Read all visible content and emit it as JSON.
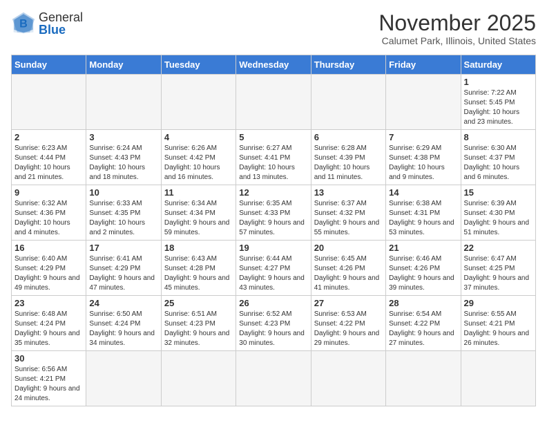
{
  "logo": {
    "general": "General",
    "blue": "Blue"
  },
  "header": {
    "month_year": "November 2025",
    "location": "Calumet Park, Illinois, United States"
  },
  "weekdays": [
    "Sunday",
    "Monday",
    "Tuesday",
    "Wednesday",
    "Thursday",
    "Friday",
    "Saturday"
  ],
  "weeks": [
    [
      {
        "day": "",
        "info": ""
      },
      {
        "day": "",
        "info": ""
      },
      {
        "day": "",
        "info": ""
      },
      {
        "day": "",
        "info": ""
      },
      {
        "day": "",
        "info": ""
      },
      {
        "day": "",
        "info": ""
      },
      {
        "day": "1",
        "info": "Sunrise: 7:22 AM\nSunset: 5:45 PM\nDaylight: 10 hours and 23 minutes."
      }
    ],
    [
      {
        "day": "2",
        "info": "Sunrise: 6:23 AM\nSunset: 4:44 PM\nDaylight: 10 hours and 21 minutes."
      },
      {
        "day": "3",
        "info": "Sunrise: 6:24 AM\nSunset: 4:43 PM\nDaylight: 10 hours and 18 minutes."
      },
      {
        "day": "4",
        "info": "Sunrise: 6:26 AM\nSunset: 4:42 PM\nDaylight: 10 hours and 16 minutes."
      },
      {
        "day": "5",
        "info": "Sunrise: 6:27 AM\nSunset: 4:41 PM\nDaylight: 10 hours and 13 minutes."
      },
      {
        "day": "6",
        "info": "Sunrise: 6:28 AM\nSunset: 4:39 PM\nDaylight: 10 hours and 11 minutes."
      },
      {
        "day": "7",
        "info": "Sunrise: 6:29 AM\nSunset: 4:38 PM\nDaylight: 10 hours and 9 minutes."
      },
      {
        "day": "8",
        "info": "Sunrise: 6:30 AM\nSunset: 4:37 PM\nDaylight: 10 hours and 6 minutes."
      }
    ],
    [
      {
        "day": "9",
        "info": "Sunrise: 6:32 AM\nSunset: 4:36 PM\nDaylight: 10 hours and 4 minutes."
      },
      {
        "day": "10",
        "info": "Sunrise: 6:33 AM\nSunset: 4:35 PM\nDaylight: 10 hours and 2 minutes."
      },
      {
        "day": "11",
        "info": "Sunrise: 6:34 AM\nSunset: 4:34 PM\nDaylight: 9 hours and 59 minutes."
      },
      {
        "day": "12",
        "info": "Sunrise: 6:35 AM\nSunset: 4:33 PM\nDaylight: 9 hours and 57 minutes."
      },
      {
        "day": "13",
        "info": "Sunrise: 6:37 AM\nSunset: 4:32 PM\nDaylight: 9 hours and 55 minutes."
      },
      {
        "day": "14",
        "info": "Sunrise: 6:38 AM\nSunset: 4:31 PM\nDaylight: 9 hours and 53 minutes."
      },
      {
        "day": "15",
        "info": "Sunrise: 6:39 AM\nSunset: 4:30 PM\nDaylight: 9 hours and 51 minutes."
      }
    ],
    [
      {
        "day": "16",
        "info": "Sunrise: 6:40 AM\nSunset: 4:29 PM\nDaylight: 9 hours and 49 minutes."
      },
      {
        "day": "17",
        "info": "Sunrise: 6:41 AM\nSunset: 4:29 PM\nDaylight: 9 hours and 47 minutes."
      },
      {
        "day": "18",
        "info": "Sunrise: 6:43 AM\nSunset: 4:28 PM\nDaylight: 9 hours and 45 minutes."
      },
      {
        "day": "19",
        "info": "Sunrise: 6:44 AM\nSunset: 4:27 PM\nDaylight: 9 hours and 43 minutes."
      },
      {
        "day": "20",
        "info": "Sunrise: 6:45 AM\nSunset: 4:26 PM\nDaylight: 9 hours and 41 minutes."
      },
      {
        "day": "21",
        "info": "Sunrise: 6:46 AM\nSunset: 4:26 PM\nDaylight: 9 hours and 39 minutes."
      },
      {
        "day": "22",
        "info": "Sunrise: 6:47 AM\nSunset: 4:25 PM\nDaylight: 9 hours and 37 minutes."
      }
    ],
    [
      {
        "day": "23",
        "info": "Sunrise: 6:48 AM\nSunset: 4:24 PM\nDaylight: 9 hours and 35 minutes."
      },
      {
        "day": "24",
        "info": "Sunrise: 6:50 AM\nSunset: 4:24 PM\nDaylight: 9 hours and 34 minutes."
      },
      {
        "day": "25",
        "info": "Sunrise: 6:51 AM\nSunset: 4:23 PM\nDaylight: 9 hours and 32 minutes."
      },
      {
        "day": "26",
        "info": "Sunrise: 6:52 AM\nSunset: 4:23 PM\nDaylight: 9 hours and 30 minutes."
      },
      {
        "day": "27",
        "info": "Sunrise: 6:53 AM\nSunset: 4:22 PM\nDaylight: 9 hours and 29 minutes."
      },
      {
        "day": "28",
        "info": "Sunrise: 6:54 AM\nSunset: 4:22 PM\nDaylight: 9 hours and 27 minutes."
      },
      {
        "day": "29",
        "info": "Sunrise: 6:55 AM\nSunset: 4:21 PM\nDaylight: 9 hours and 26 minutes."
      }
    ],
    [
      {
        "day": "30",
        "info": "Sunrise: 6:56 AM\nSunset: 4:21 PM\nDaylight: 9 hours and 24 minutes."
      },
      {
        "day": "",
        "info": ""
      },
      {
        "day": "",
        "info": ""
      },
      {
        "day": "",
        "info": ""
      },
      {
        "day": "",
        "info": ""
      },
      {
        "day": "",
        "info": ""
      },
      {
        "day": "",
        "info": ""
      }
    ]
  ]
}
